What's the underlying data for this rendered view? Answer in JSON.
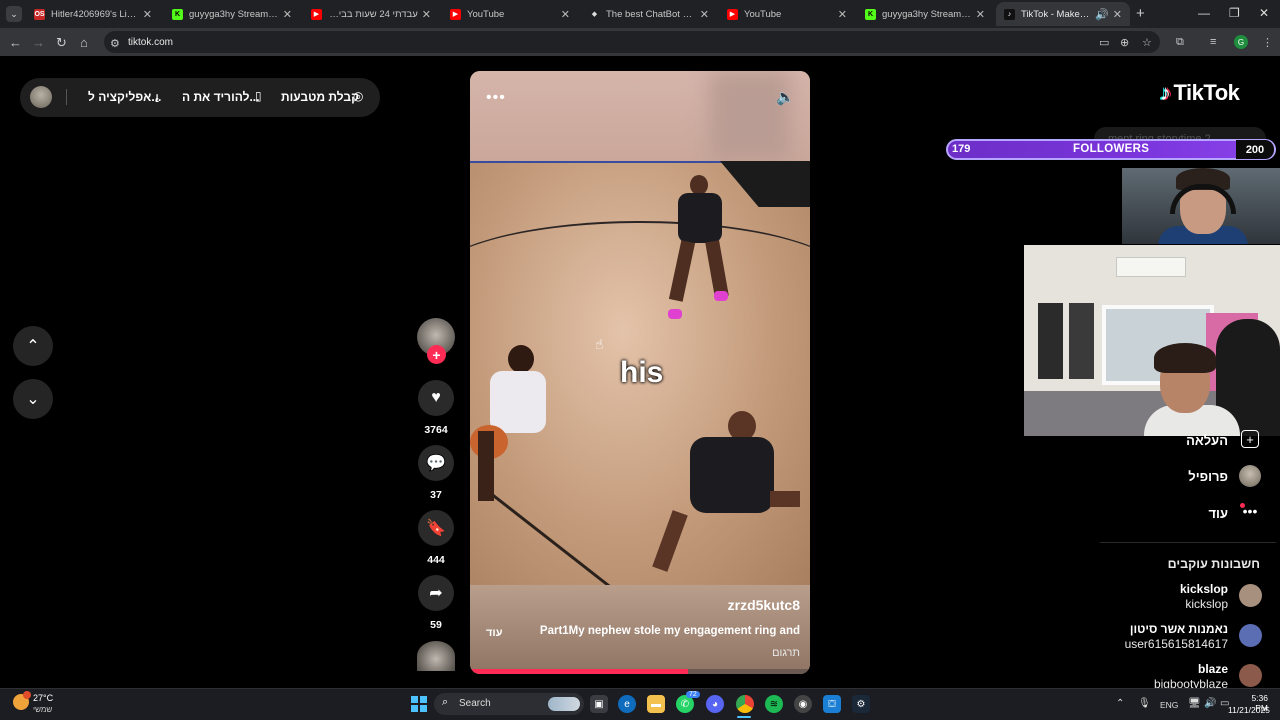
{
  "browser": {
    "tabs": [
      {
        "title": "Hitler4206969's Library | L",
        "favicon_color": "#c62828",
        "favicon_text": "OS"
      },
      {
        "title": "guyyga3hy Stream - Kick",
        "favicon_color": "#53fc18",
        "favicon_text": "K"
      },
      {
        "title": "עבדתי 24 שעות בבית קפה",
        "favicon_color": "#ff0000",
        "favicon_text": "▶"
      },
      {
        "title": "YouTube",
        "favicon_color": "#ff0000",
        "favicon_text": "▶"
      },
      {
        "title": "The best ChatBot and Wi",
        "favicon_color": "#dddddd",
        "favicon_text": "◆"
      },
      {
        "title": "YouTube",
        "favicon_color": "#ff0000",
        "favicon_text": "▶"
      },
      {
        "title": "guyyga3hy Stream - Kick",
        "favicon_color": "#53fc18",
        "favicon_text": "K"
      },
      {
        "title": "TikTok - Make Your D",
        "favicon_color": "#111111",
        "favicon_text": "♪",
        "active": true
      }
    ],
    "url": "tiktok.com",
    "profile_initial": "G"
  },
  "topbar": {
    "coins": "קבלת מטבעות",
    "download_app": "להוריד את ה...",
    "app": "אפליקציה ל..."
  },
  "video": {
    "caption": "his",
    "username": "zrzd5kutc8",
    "description": "Part1My nephew stole my engagement ring and",
    "more": "עוד",
    "translate": "תרגום",
    "progress": 0.64,
    "progress_color": "#fe2c55"
  },
  "actions": {
    "likes": "3764",
    "comments": "37",
    "saves": "444",
    "shares": "59"
  },
  "sidebar": {
    "logo": "TikTok",
    "search_placeholder": "ment ring storytime 2",
    "followers_goal": {
      "current": "179",
      "label": "FOLLOWERS",
      "target": "200"
    },
    "menu": {
      "upload": "העלאה",
      "profile": "פרופיל",
      "more": "עוד"
    },
    "following_title": "חשבונות עוקבים",
    "accounts": [
      {
        "name": "kickslop",
        "handle": "kickslop",
        "color": "#a8907e"
      },
      {
        "name": "נאמנות אשר סיטון",
        "handle": "user615615814617",
        "color": "#5b6db3"
      },
      {
        "name": "blaze",
        "handle": "bigbootyblaze",
        "color": "#8b5a4a"
      }
    ]
  },
  "taskbar": {
    "temperature": "27°C",
    "weather_text": "שמשי",
    "search": "Search",
    "language": "ENG",
    "time": "5:36 PM",
    "date": "11/21/2025",
    "badge": "72"
  }
}
